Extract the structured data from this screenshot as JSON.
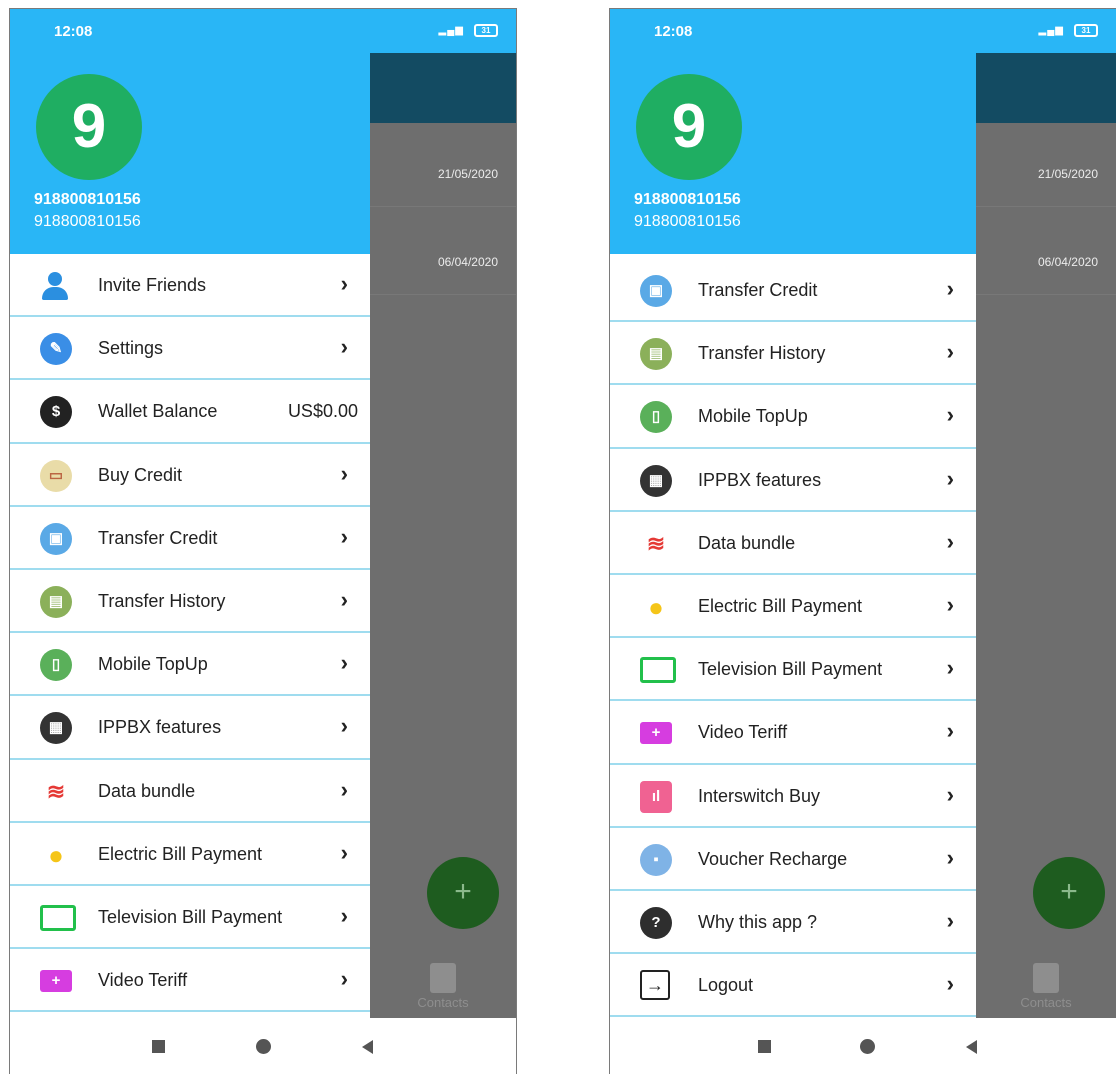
{
  "status": {
    "time": "12:08",
    "battery": "31"
  },
  "user": {
    "initial": "9",
    "name": "918800810156",
    "number": "918800810156"
  },
  "background": {
    "dates": [
      "21/05/2020",
      "06/04/2020"
    ],
    "contacts_label": "Contacts",
    "fab": "+"
  },
  "chevron": "›",
  "left_menu": [
    {
      "label": "Invite Friends",
      "icon": "add-user-icon"
    },
    {
      "label": "Settings",
      "icon": "settings-wrench-icon"
    },
    {
      "label": "Wallet Balance",
      "icon": "dollar-badge-icon",
      "value": "US$0.00"
    },
    {
      "label": "Buy Credit",
      "icon": "credit-card-icon"
    },
    {
      "label": "Transfer Credit",
      "icon": "transfer-credit-icon"
    },
    {
      "label": "Transfer History",
      "icon": "transfer-history-icon"
    },
    {
      "label": "Mobile TopUp",
      "icon": "mobile-topup-icon"
    },
    {
      "label": "IPPBX features",
      "icon": "keypad-icon"
    },
    {
      "label": "Data bundle",
      "icon": "wifi-signal-icon"
    },
    {
      "label": "Electric Bill Payment",
      "icon": "light-bulb-icon"
    },
    {
      "label": "Television Bill Payment",
      "icon": "television-icon"
    },
    {
      "label": "Video Teriff",
      "icon": "video-camera-icon"
    }
  ],
  "right_menu": [
    {
      "label": "Transfer Credit",
      "icon": "transfer-credit-icon"
    },
    {
      "label": "Transfer History",
      "icon": "transfer-history-icon"
    },
    {
      "label": "Mobile TopUp",
      "icon": "mobile-topup-icon"
    },
    {
      "label": "IPPBX features",
      "icon": "keypad-icon"
    },
    {
      "label": "Data bundle",
      "icon": "wifi-signal-icon"
    },
    {
      "label": "Electric Bill Payment",
      "icon": "light-bulb-icon"
    },
    {
      "label": "Television Bill Payment",
      "icon": "television-icon"
    },
    {
      "label": "Video Teriff",
      "icon": "video-camera-icon"
    },
    {
      "label": "Interswitch Buy",
      "icon": "bar-chart-icon"
    },
    {
      "label": "Voucher Recharge",
      "icon": "voucher-icon"
    },
    {
      "label": "Why this app ?",
      "icon": "question-icon"
    },
    {
      "label": "Logout",
      "icon": "logout-icon"
    }
  ]
}
